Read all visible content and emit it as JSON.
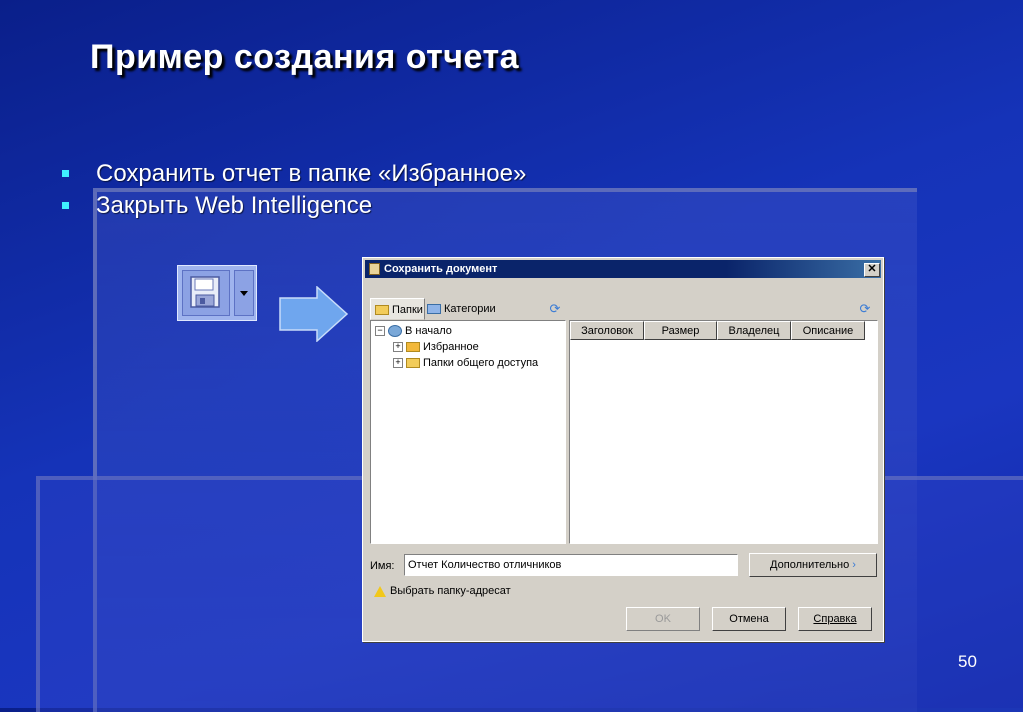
{
  "slide": {
    "title": "Пример создания отчета",
    "bullets": [
      "Сохранить отчет в папке «Избранное»",
      "Закрыть Web Intelligence"
    ],
    "page_number": "50"
  },
  "toolbar": {
    "save_icon": "floppy-disk-icon",
    "dropdown_icon": "caret-down-icon"
  },
  "dialog": {
    "title": "Сохранить документ",
    "close_glyph": "✕",
    "tabs": [
      {
        "label": "Папки"
      },
      {
        "label": "Категории"
      }
    ],
    "tree": [
      {
        "label": "В начало",
        "toggle": "−"
      },
      {
        "label": "Избранное",
        "toggle": "+"
      },
      {
        "label": "Папки общего доступа",
        "toggle": "+"
      }
    ],
    "columns": [
      "Заголовок",
      "Размер",
      "Владелец",
      "Описание"
    ],
    "name_label": "Имя:",
    "name_value": "Отчет Количество отличников",
    "advanced_button": "Дополнительно",
    "warning": "Выбрать папку-адресат",
    "buttons": {
      "ok": "OK",
      "cancel": "Отмена",
      "help": "Справка"
    }
  },
  "colors": {
    "background": "#1533b8",
    "bullet": "#3ff0ff",
    "titlebar": "#0a246a"
  }
}
